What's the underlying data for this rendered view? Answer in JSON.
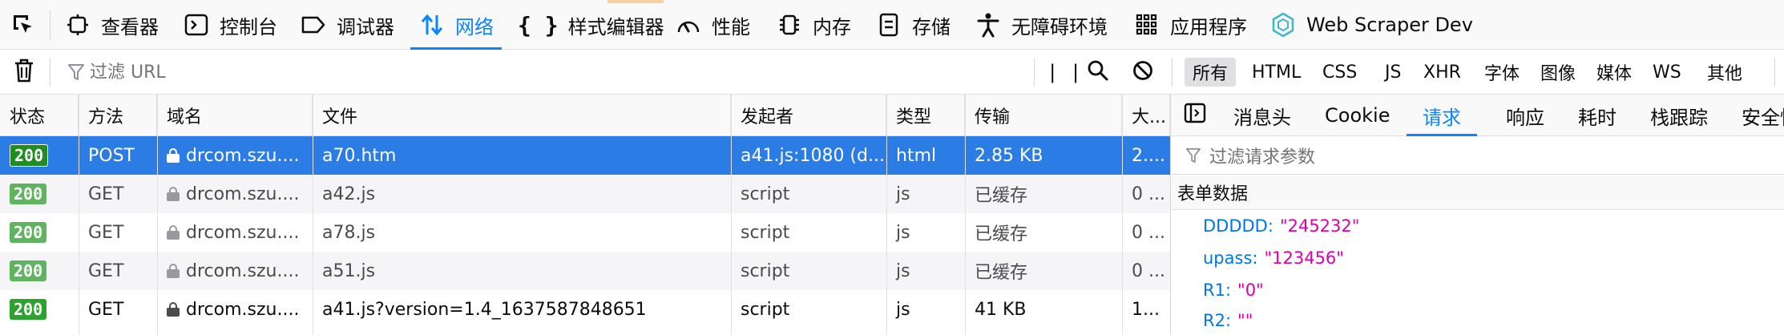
{
  "toolbar": {
    "tabs": [
      {
        "label": "查看器",
        "icon": "inspector-icon"
      },
      {
        "label": "控制台",
        "icon": "console-icon"
      },
      {
        "label": "调试器",
        "icon": "debugger-icon"
      },
      {
        "label": "网络",
        "icon": "network-arrows-icon",
        "active": true
      },
      {
        "label": "样式编辑器",
        "icon": "style-editor-braces-icon"
      },
      {
        "label": "性能",
        "icon": "performance-gauge-icon"
      },
      {
        "label": "内存",
        "icon": "memory-chip-icon"
      },
      {
        "label": "存储",
        "icon": "storage-icon"
      },
      {
        "label": "无障碍环境",
        "icon": "accessibility-person-icon"
      },
      {
        "label": "应用程序",
        "icon": "application-grid-icon"
      },
      {
        "label": "Web Scraper Dev",
        "icon": "web-scraper-hexagon-icon"
      }
    ],
    "accent_color": "#0a84ff"
  },
  "filterbar": {
    "placeholder": "过滤 URL",
    "types": [
      "所有",
      "HTML",
      "CSS",
      "JS",
      "XHR",
      "字体",
      "图像",
      "媒体",
      "WS",
      "其他"
    ],
    "selected_type": "所有"
  },
  "table": {
    "columns": [
      "状态",
      "方法",
      "域名",
      "文件",
      "发起者",
      "类型",
      "传输",
      "大..."
    ],
    "rows": [
      {
        "status": "200",
        "method": "POST",
        "domain": "drcom.szu....",
        "file": "a70.htm",
        "initiator": "a41.js:1080 (d...",
        "type": "html",
        "transferred": "2.85 KB",
        "size": "2....",
        "state": "selected"
      },
      {
        "status": "200",
        "method": "GET",
        "domain": "drcom.szu....",
        "file": "a42.js",
        "initiator": "script",
        "type": "js",
        "transferred": "已缓存",
        "size": "0 ...",
        "state": "cached"
      },
      {
        "status": "200",
        "method": "GET",
        "domain": "drcom.szu....",
        "file": "a78.js",
        "initiator": "script",
        "type": "js",
        "transferred": "已缓存",
        "size": "0 ...",
        "state": "cached"
      },
      {
        "status": "200",
        "method": "GET",
        "domain": "drcom.szu....",
        "file": "a51.js",
        "initiator": "script",
        "type": "js",
        "transferred": "已缓存",
        "size": "0 ...",
        "state": "cached"
      },
      {
        "status": "200",
        "method": "GET",
        "domain": "drcom.szu....",
        "file": "a41.js?version=1.4_1637587848651",
        "initiator": "script",
        "type": "js",
        "transferred": "41 KB",
        "size": "1...",
        "state": "normal"
      }
    ]
  },
  "details": {
    "tabs": [
      "消息头",
      "Cookie",
      "请求",
      "响应",
      "耗时",
      "栈跟踪",
      "安全性"
    ],
    "active_tab": "请求",
    "filter_placeholder": "过滤请求参数",
    "section_title": "表单数据",
    "params": [
      {
        "key": "DDDDD:",
        "value": "\"245232\""
      },
      {
        "key": "upass:",
        "value": "\"123456\""
      },
      {
        "key": "R1:",
        "value": "\"0\""
      },
      {
        "key": "R2:",
        "value": "\"\""
      }
    ]
  }
}
